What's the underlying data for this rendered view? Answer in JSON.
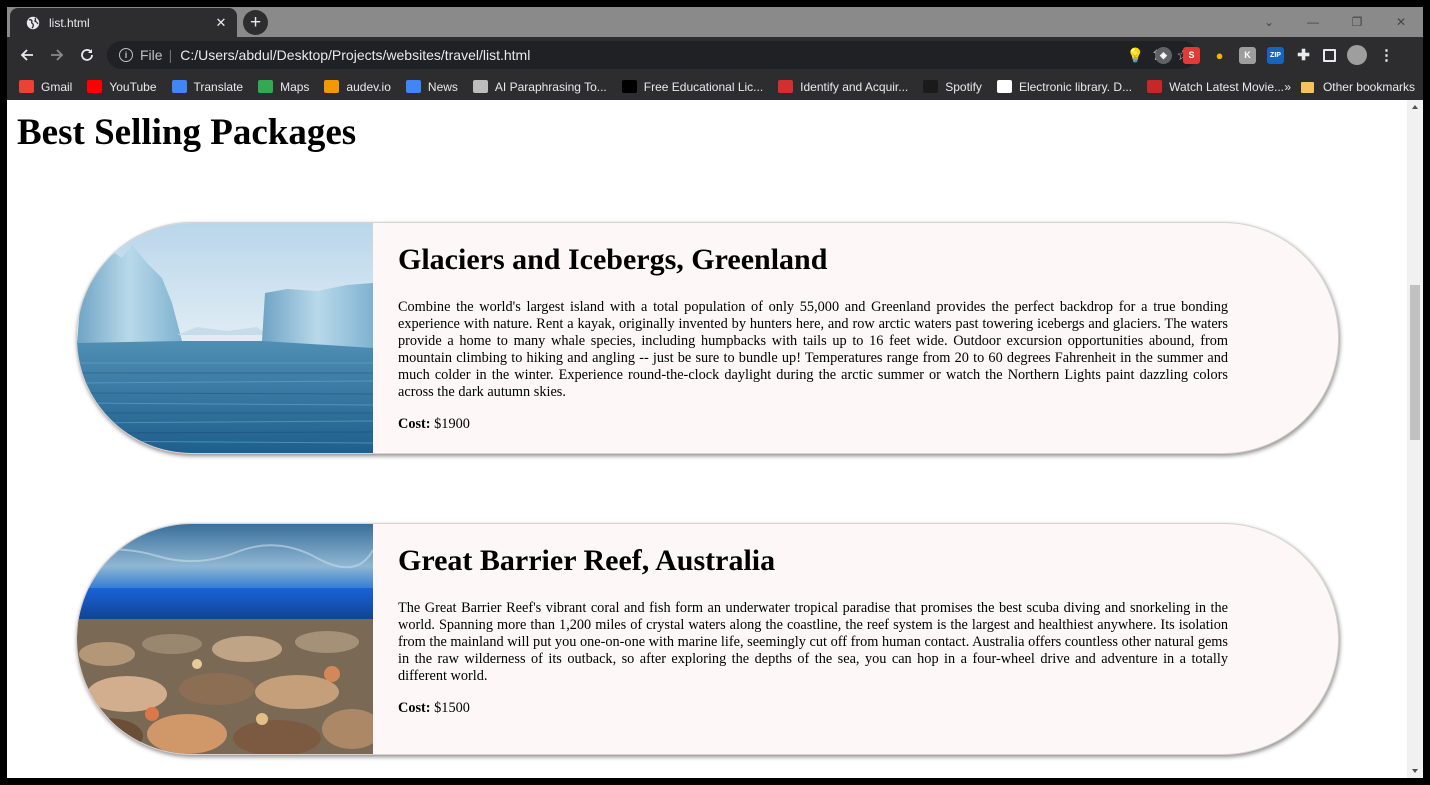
{
  "browser": {
    "tab_title": "list.html",
    "omnibox_scheme": "File",
    "omnibox_url": "C:/Users/abdul/Desktop/Projects/websites/travel/list.html"
  },
  "bookmarks": [
    {
      "label": "Gmail",
      "icon": "gmail-icon",
      "color": "#ea4335"
    },
    {
      "label": "YouTube",
      "icon": "youtube-icon",
      "color": "#ff0000"
    },
    {
      "label": "Translate",
      "icon": "translate-icon",
      "color": "#4285f4"
    },
    {
      "label": "Maps",
      "icon": "maps-icon",
      "color": "#34a853"
    },
    {
      "label": "audev.io",
      "icon": "audev-icon",
      "color": "#f29900"
    },
    {
      "label": "News",
      "icon": "news-icon",
      "color": "#4285f4"
    },
    {
      "label": "AI Paraphrasing To...",
      "icon": "quill-icon",
      "color": "#bdbdbd"
    },
    {
      "label": "Free Educational Lic...",
      "icon": "jetbrains-icon",
      "color": "#000000"
    },
    {
      "label": "Identify and Acquir...",
      "icon": "identify-icon",
      "color": "#d32f2f"
    },
    {
      "label": "Spotify",
      "icon": "spotify-icon",
      "color": "#1a1a1a"
    },
    {
      "label": "Electronic library. D...",
      "icon": "library-icon",
      "color": "#ffffff"
    },
    {
      "label": "Watch Latest Movie...",
      "icon": "movie-icon",
      "color": "#c62828"
    }
  ],
  "bookmarks_overflow": "»",
  "other_bookmarks": "Other bookmarks",
  "page": {
    "heading": "Best Selling Packages",
    "packages": [
      {
        "title": "Glaciers and Icebergs, Greenland",
        "description": "Combine the world's largest island with a total population of only 55,000 and Greenland provides the perfect backdrop for a true bonding experience with nature. Rent a kayak, originally invented by hunters here, and row arctic waters past towering icebergs and glaciers. The waters provide a home to many whale species, including humpbacks with tails up to 16 feet wide. Outdoor excursion opportunities abound, from mountain climbing to hiking and angling -- just be sure to bundle up! Temperatures range from 20 to 60 degrees Fahrenheit in the summer and much colder in the winter. Experience round-the-clock daylight during the arctic summer or watch the Northern Lights paint dazzling colors across the dark autumn skies.",
        "cost_label": "Cost:",
        "cost_value": "$1900"
      },
      {
        "title": "Great Barrier Reef, Australia",
        "description": "The Great Barrier Reef's vibrant coral and fish form an underwater tropical paradise that promises the best scuba diving and snorkeling in the world. Spanning more than 1,200 miles of crystal waters along the coastline, the reef system is the largest and healthiest anywhere. Its isolation from the mainland will put you one-on-one with marine life, seemingly cut off from human contact. Australia offers countless other natural gems in the raw wilderness of its outback, so after exploring the depths of the sea, you can hop in a four-wheel drive and adventure in a totally different world.",
        "cost_label": "Cost:",
        "cost_value": "$1500"
      }
    ]
  }
}
